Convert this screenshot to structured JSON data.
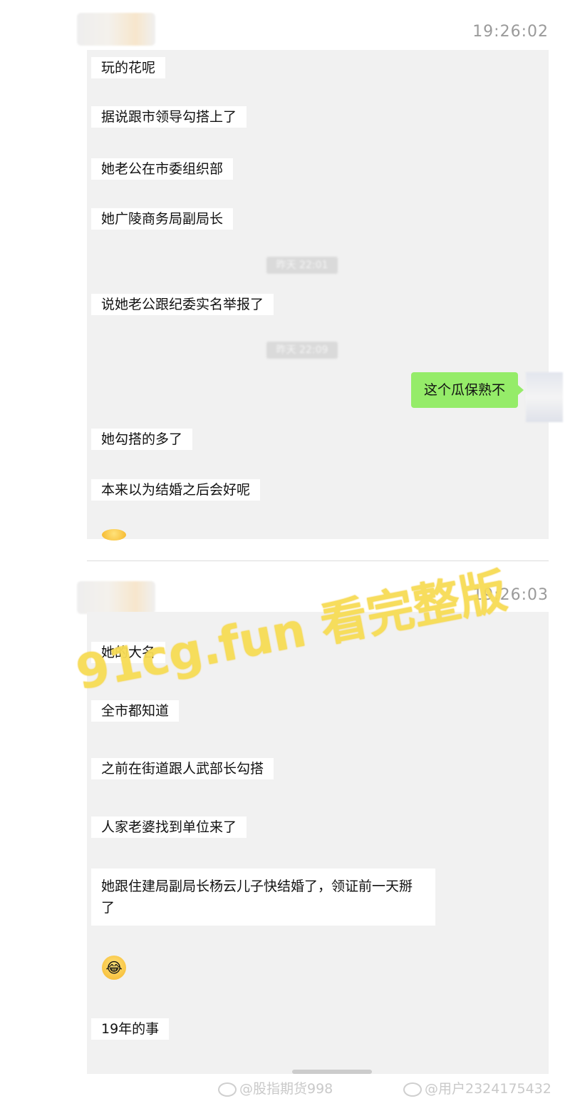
{
  "screen1": {
    "timestamp": "19:26:02",
    "messages": [
      "玩的花呢",
      "据说跟市领导勾搭上了",
      "她老公在市委组织部",
      "她广陵商务局副局长",
      "说她老公跟纪委实名举报了",
      "她勾搭的多了",
      "本来以为结婚之后会好呢"
    ],
    "system_times": [
      "昨天 22:01",
      "昨天 22:09"
    ],
    "sent_message": "这个瓜保熟不"
  },
  "screen2": {
    "timestamp": "19:26:03",
    "messages": [
      "她的大名",
      "全市都知道",
      "之前在街道跟人武部长勾搭",
      "人家老婆找到单位来了",
      "她跟住建局副局长杨云儿子快结婚了，领证前一天掰了",
      "19年的事"
    ],
    "emoji": "😂"
  },
  "watermark": {
    "text": "91cg.fun 看完整版",
    "color": "#f7dc55"
  },
  "footer": {
    "handle1": "@股指期货998",
    "handle2": "@用户2324175432"
  }
}
